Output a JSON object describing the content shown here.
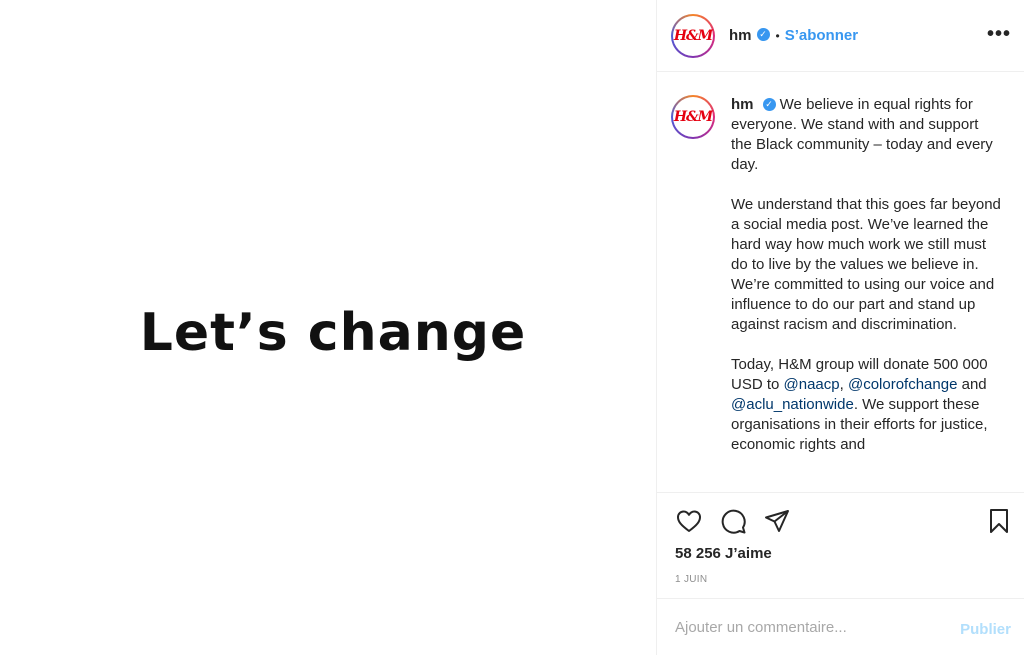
{
  "post": {
    "image_text": "Let’s change"
  },
  "header": {
    "avatar_text": "H&M",
    "username": "hm",
    "follow_label": "S’abonner",
    "separator": "•",
    "more_label": "•••"
  },
  "caption": {
    "username": "hm",
    "paragraphs": [
      "We believe in equal rights for everyone. We stand with and support the Black community – today and every day.",
      "We understand that this goes far beyond a social media post. We’ve learned the hard way how much work we still must do to live by the values we believe in. We’re committed to using our voice and influence to do our part and stand up against racism and discrimination."
    ],
    "p3_start": "Today, H&M group will donate 500 000 USD to ",
    "mention_1": "@naacp",
    "mention_sep_1": ", ",
    "mention_2": "@colorofchange",
    "mention_sep_2": " and ",
    "mention_3": "@aclu_nationwide",
    "p3_end": ". We support these organisations in their efforts for justice, economic rights and"
  },
  "engagement": {
    "likes": "58 256 J’aime",
    "date": "1 JUIN"
  },
  "comment": {
    "placeholder": "Ajouter un commentaire...",
    "publish_label": "Publier"
  },
  "colors": {
    "accent": "#3897f0",
    "brand_red": "#e50010",
    "mention": "#00376b",
    "publish_disabled": "#b2dffc"
  },
  "icons": [
    "verified-badge-icon",
    "heart-icon",
    "comment-icon",
    "share-icon",
    "bookmark-icon",
    "more-icon"
  ]
}
